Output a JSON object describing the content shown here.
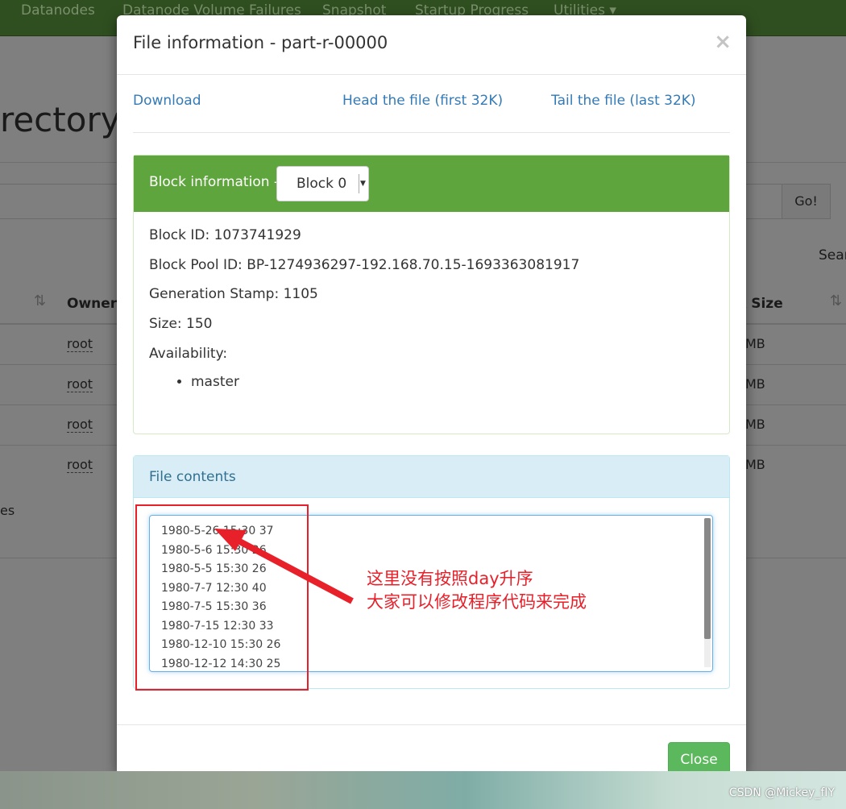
{
  "nav": [
    "Datanodes",
    "Datanode Volume Failures",
    "Snapshot",
    "Startup Progress",
    "Utilities ▾"
  ],
  "background": {
    "heading": "rectory",
    "go": "Go!",
    "search": "Sear",
    "col_owner": "Owner",
    "col_block_size": "k Size",
    "rows": [
      {
        "owner": "root",
        "size": "MB"
      },
      {
        "owner": "root",
        "size": "MB"
      },
      {
        "owner": "root",
        "size": "MB"
      },
      {
        "owner": "root",
        "size": "MB"
      }
    ],
    "footer": "es"
  },
  "modal": {
    "title": "File information - part-r-00000",
    "close_x": "×",
    "links": {
      "download": "Download",
      "head": "Head the file (first 32K)",
      "tail": "Tail the file (last 32K)"
    },
    "block": {
      "header": "Block information --",
      "selected": "Block 0",
      "id": "Block ID: 1073741929",
      "pool": "Block Pool ID: BP-1274936297-192.168.70.15-1693363081917",
      "stamp": "Generation Stamp: 1105",
      "size": "Size: 150",
      "availability": "Availability:",
      "nodes": [
        "master"
      ]
    },
    "contents": {
      "header": "File contents",
      "lines": [
        "1980-5-26  15:30  37",
        "1980-5-6  15:30  26",
        "1980-5-5  15:30  26",
        "1980-7-7  12:30  40",
        "1980-7-5  15:30  36",
        "1980-7-15  12:30  33",
        "1980-12-10  15:30  26",
        "1980-12-12  14:30  25"
      ]
    },
    "close": "Close"
  },
  "annotation": {
    "line1": "这里没有按照day升序",
    "line2": "大家可以修改程序代码来完成",
    "color": "#e8202a"
  },
  "watermark": "CSDN @Mickey_fIY"
}
